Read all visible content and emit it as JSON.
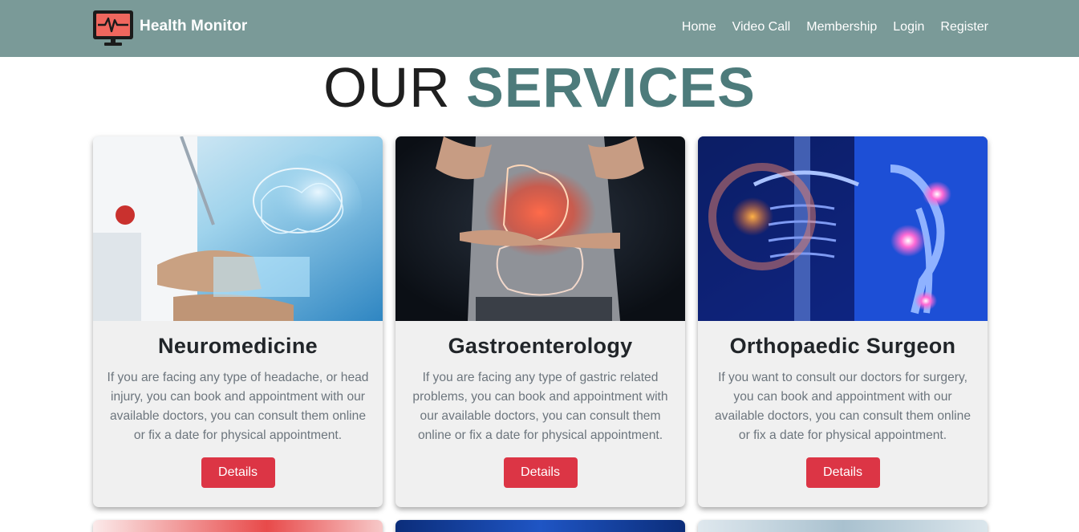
{
  "brand": {
    "name": "Health Monitor",
    "logo_icon": "monitor-heartbeat-icon"
  },
  "nav": {
    "items": [
      {
        "label": "Home"
      },
      {
        "label": "Video Call"
      },
      {
        "label": "Membership"
      },
      {
        "label": "Login"
      },
      {
        "label": "Register"
      }
    ]
  },
  "section": {
    "title_light": "OUR",
    "title_bold": "SERVICES"
  },
  "services": [
    {
      "title": "Neuromedicine",
      "description": "If you are facing any type of headache, or head injury, you can book and appointment with our available doctors, you can consult them online or fix a date for physical appointment.",
      "button_label": "Details",
      "image": "doctor-brain-hologram-image"
    },
    {
      "title": "Gastroenterology",
      "description": "If you are facing any type of gastric related problems, you can book and appointment with our available doctors, you can consult them online or fix a date for physical appointment.",
      "button_label": "Details",
      "image": "stomach-pain-illustration-image"
    },
    {
      "title": "Orthopaedic Surgeon",
      "description": "If you want to consult our doctors for surgery, you can book and appointment with our available doctors, you can consult them online or fix a date for physical appointment.",
      "button_label": "Details",
      "image": "skeleton-joint-pain-xray-image"
    }
  ],
  "colors": {
    "navbar": "#7a9a98",
    "accent": "#4d7b7b",
    "button": "#dc3545",
    "card_bg": "#f0f0f0"
  }
}
